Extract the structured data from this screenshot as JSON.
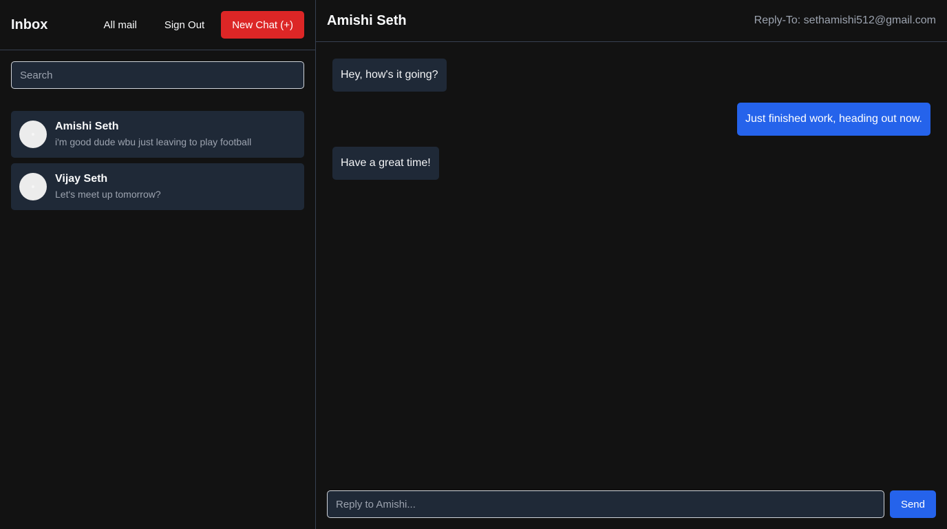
{
  "sidebar": {
    "title": "Inbox",
    "nav": {
      "all_mail": "All mail",
      "sign_out": "Sign Out",
      "new_chat": "New Chat (+)"
    },
    "search": {
      "placeholder": "Search",
      "value": ""
    },
    "conversations": [
      {
        "name": "Amishi Seth",
        "preview": "i'm good dude wbu just leaving to play football"
      },
      {
        "name": "Vijay Seth",
        "preview": "Let's meet up tomorrow?"
      }
    ]
  },
  "chat": {
    "title": "Amishi Seth",
    "reply_to": "Reply-To: sethamishi512@gmail.com",
    "messages": [
      {
        "text": "Hey, how's it going?",
        "direction": "incoming"
      },
      {
        "text": "Just finished work, heading out now.",
        "direction": "outgoing"
      },
      {
        "text": "Have a great time!",
        "direction": "incoming"
      }
    ],
    "composer": {
      "placeholder": "Reply to Amishi...",
      "value": "",
      "send_label": "Send"
    }
  },
  "colors": {
    "background": "#121212",
    "panel": "#1f2937",
    "new_chat_button": "#dc2626",
    "outgoing_bubble": "#2563eb",
    "send_button": "#2563eb",
    "divider": "#374151"
  }
}
